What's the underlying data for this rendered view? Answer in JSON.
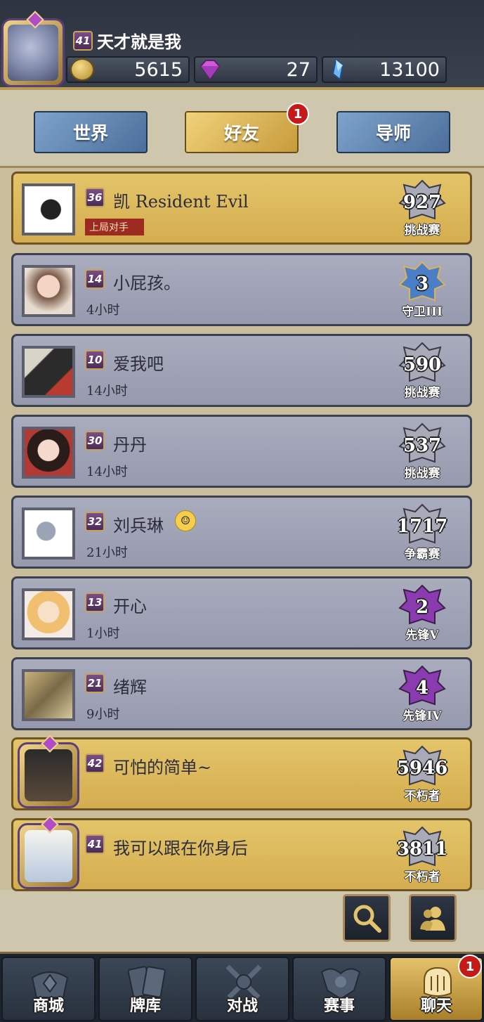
{
  "player": {
    "level": "41",
    "name": "天才就是我",
    "coins": "5615",
    "gems": "27",
    "crystals": "13100"
  },
  "tabs": {
    "world": "世界",
    "friends": "好友",
    "mentor": "导师",
    "friends_badge": "1"
  },
  "friends": [
    {
      "level": "36",
      "name": "凯   Resident  Evil",
      "sub": "上局对手",
      "rank_value": "927",
      "rank_label": "挑战赛",
      "style": "gold",
      "rank_color": "#a8aab8"
    },
    {
      "level": "14",
      "name": "小屁孩。",
      "sub": "4小时",
      "rank_value": "3",
      "rank_label": "守卫III",
      "style": "blue",
      "rank_color": "#4a7fc8"
    },
    {
      "level": "10",
      "name": "爱我吧",
      "sub": "14小时",
      "rank_value": "590",
      "rank_label": "挑战赛",
      "style": "blue",
      "rank_color": "#a8aab8"
    },
    {
      "level": "30",
      "name": "丹丹",
      "sub": "14小时",
      "rank_value": "537",
      "rank_label": "挑战赛",
      "style": "blue",
      "rank_color": "#a8aab8"
    },
    {
      "level": "32",
      "name": "刘兵琳",
      "sub": "21小时",
      "rank_value": "1717",
      "rank_label": "争霸赛",
      "style": "blue",
      "rank_color": "#a8aab8"
    },
    {
      "level": "13",
      "name": "开心",
      "sub": "1小时",
      "rank_value": "2",
      "rank_label": "先锋V",
      "style": "blue",
      "rank_color": "#8a3bb0"
    },
    {
      "level": "21",
      "name": "绪辉",
      "sub": "9小时",
      "rank_value": "4",
      "rank_label": "先锋IV",
      "style": "blue",
      "rank_color": "#8a3bb0"
    },
    {
      "level": "42",
      "name": "可怕的简单~",
      "sub": "",
      "rank_value": "5946",
      "rank_label": "不朽者",
      "style": "gold-frame",
      "rank_color": "#a8aab8"
    },
    {
      "level": "41",
      "name": "我可以跟在你身后",
      "sub": "",
      "rank_value": "3811",
      "rank_label": "不朽者",
      "style": "gold-frame",
      "rank_color": "#a8aab8"
    }
  ],
  "nav": {
    "shop": "商城",
    "deck": "牌库",
    "battle": "对战",
    "events": "赛事",
    "chat": "聊天",
    "chat_badge": "1"
  },
  "icons": [
    "coin-icon",
    "gem-icon",
    "crystal-icon",
    "search-icon",
    "friends-icon",
    "shop-icon",
    "deck-icon",
    "battle-icon",
    "events-icon",
    "chat-icon"
  ],
  "colors": {
    "gold": "#d4ad4f",
    "tab_blue": "#5f83ad",
    "badge_red": "#c41a1a",
    "row_gray": "#a1a4b6"
  }
}
